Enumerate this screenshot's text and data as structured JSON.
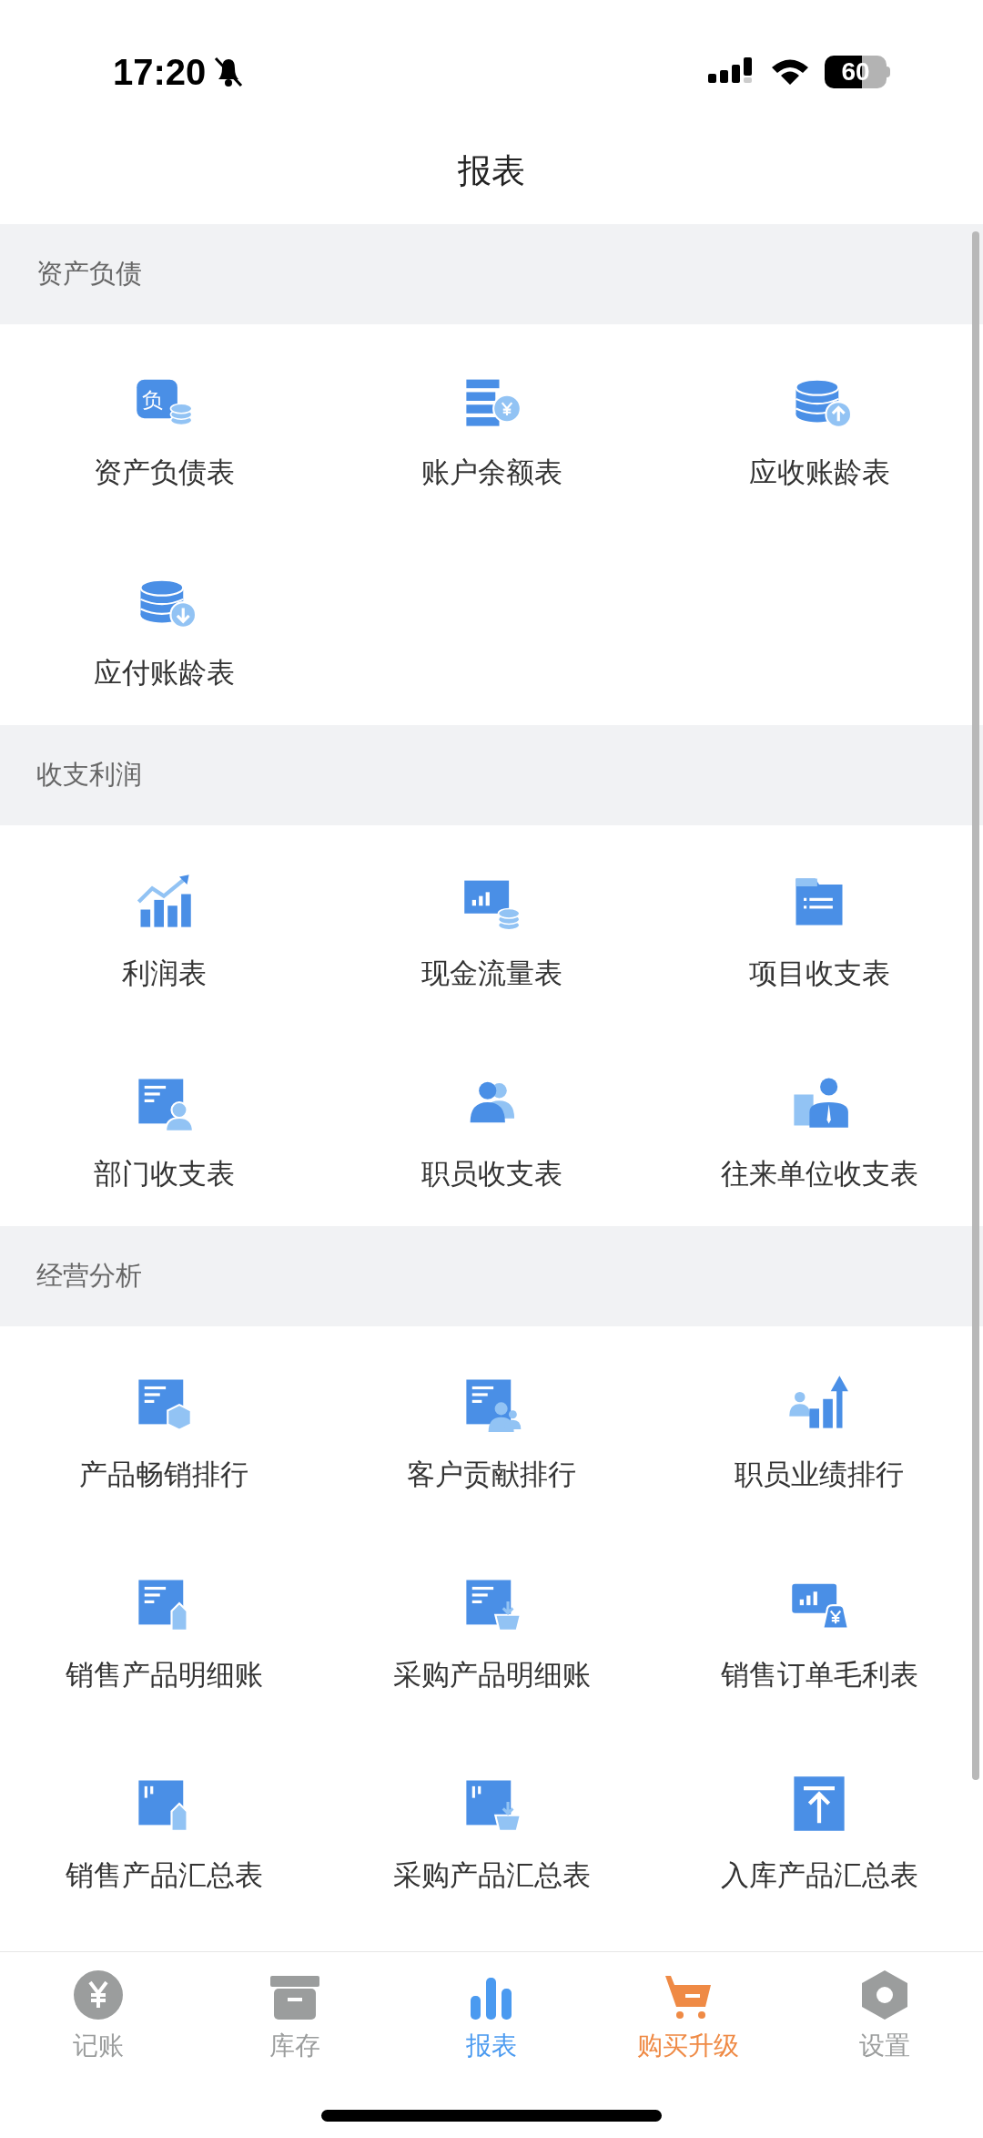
{
  "status_bar": {
    "time": "17:20",
    "battery": "60"
  },
  "title": "报表",
  "sections": [
    {
      "title": "资产负债",
      "items": [
        {
          "label": "资产负债表",
          "icon_text": "负"
        },
        {
          "label": "账户余额表"
        },
        {
          "label": "应收账龄表"
        },
        {
          "label": "应付账龄表"
        }
      ]
    },
    {
      "title": "收支利润",
      "items": [
        {
          "label": "利润表"
        },
        {
          "label": "现金流量表"
        },
        {
          "label": "项目收支表"
        },
        {
          "label": "部门收支表"
        },
        {
          "label": "职员收支表"
        },
        {
          "label": "往来单位收支表"
        }
      ]
    },
    {
      "title": "经营分析",
      "items": [
        {
          "label": "产品畅销排行"
        },
        {
          "label": "客户贡献排行"
        },
        {
          "label": "职员业绩排行"
        },
        {
          "label": "销售产品明细账"
        },
        {
          "label": "采购产品明细账"
        },
        {
          "label": "销售订单毛利表"
        },
        {
          "label": "销售产品汇总表"
        },
        {
          "label": "采购产品汇总表"
        },
        {
          "label": "入库产品汇总表"
        }
      ]
    }
  ],
  "tabs": [
    {
      "label": "记账",
      "selected": false,
      "kind": "normal"
    },
    {
      "label": "库存",
      "selected": false,
      "kind": "normal"
    },
    {
      "label": "报表",
      "selected": true,
      "kind": "normal"
    },
    {
      "label": "购买升级",
      "selected": false,
      "kind": "promo"
    },
    {
      "label": "设置",
      "selected": false,
      "kind": "normal"
    }
  ]
}
